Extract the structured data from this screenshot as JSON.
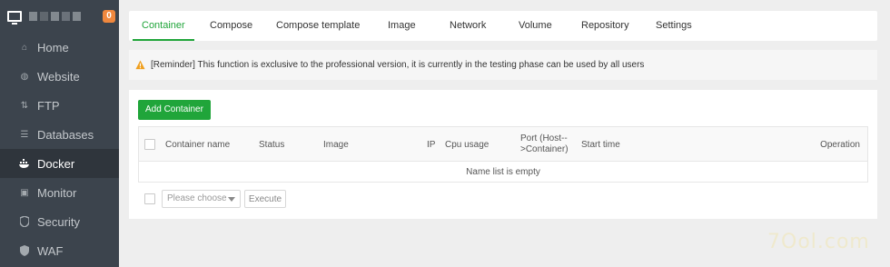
{
  "sidebar": {
    "badge_count": "0",
    "items": [
      {
        "label": "Home",
        "icon": "home-icon",
        "active": false
      },
      {
        "label": "Website",
        "icon": "globe-icon",
        "active": false
      },
      {
        "label": "FTP",
        "icon": "ftp-icon",
        "active": false
      },
      {
        "label": "Databases",
        "icon": "database-icon",
        "active": false
      },
      {
        "label": "Docker",
        "icon": "docker-icon",
        "active": true
      },
      {
        "label": "Monitor",
        "icon": "monitor-icon",
        "active": false
      },
      {
        "label": "Security",
        "icon": "shield-icon",
        "active": false
      },
      {
        "label": "WAF",
        "icon": "waf-icon",
        "active": false
      }
    ]
  },
  "tabs": [
    {
      "label": "Container",
      "active": true
    },
    {
      "label": "Compose"
    },
    {
      "label": "Compose template"
    },
    {
      "label": "Image"
    },
    {
      "label": "Network"
    },
    {
      "label": "Volume"
    },
    {
      "label": "Repository"
    },
    {
      "label": "Settings"
    }
  ],
  "reminder": {
    "text": "[Reminder] This function is exclusive to the professional version, it is currently in the testing phase can be used by all users",
    "icon_color": "#f0a020"
  },
  "main": {
    "add_button": "Add Container",
    "columns": [
      "Container name",
      "Status",
      "Image",
      "IP",
      "Cpu usage",
      "Port (Host-->Container)",
      "Start time",
      "Operation"
    ],
    "empty_text": "Name list is empty",
    "batch_select_placeholder": "Please choose",
    "execute_button": "Execute"
  },
  "watermark": "7Ool.com",
  "colors": {
    "accent": "#20a53a",
    "sidebar_bg": "#3c444d",
    "badge": "#f0883e"
  }
}
